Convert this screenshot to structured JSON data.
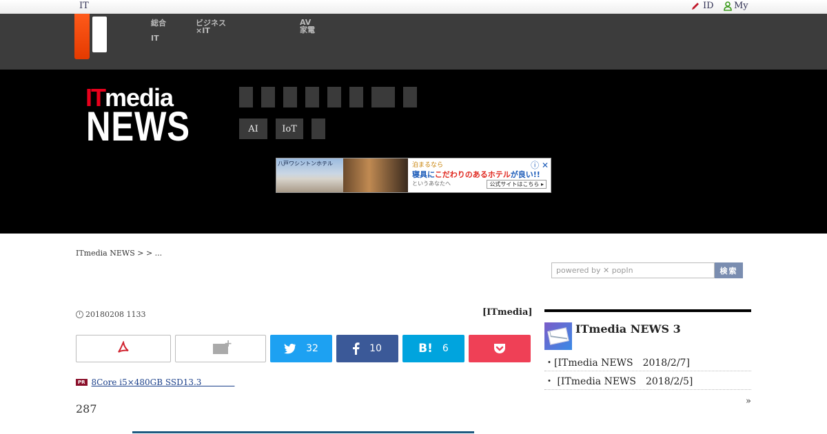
{
  "topbar": {
    "brand": "IT",
    "id_label": "ID",
    "my_label": "My",
    "pencil_icon": "pencil-icon",
    "person_icon": "person-icon"
  },
  "network_nav": {
    "items": [
      {
        "line1": "総合",
        "line2": "IT"
      },
      {
        "line1": "ビジネス",
        "line2": "×IT"
      },
      {
        "line1": "AV",
        "line2": "家電"
      }
    ]
  },
  "header": {
    "logo_it": "IT",
    "logo_media": "media",
    "logo_news": "NEWS",
    "categories_row1": [
      "",
      "",
      "",
      "",
      "",
      "",
      "",
      ""
    ],
    "categories_row2": [
      "AI",
      "IoT",
      ""
    ]
  },
  "ad": {
    "hotel_tag": "八戸ワシントンホテル",
    "line1": "泊まるなら",
    "line2a": "寝具に",
    "line2b": "こだわりのあるホテル",
    "line2c": "が良い!!",
    "line3": "というあなたへ",
    "cta": "公式サイトはこちら ▸",
    "close": "ⓘ ✕"
  },
  "breadcrumb": "ITmedia NEWS >  > ...",
  "search": {
    "placeholder": "powered by ✕ popIn",
    "button_label": "検索"
  },
  "article": {
    "date": "20180208 1133",
    "byline": "[ITmedia]",
    "share": {
      "twitter_count": "32",
      "facebook_count": "10",
      "hatena_label": "B!",
      "hatena_count": "6"
    },
    "pr_badge": "PR",
    "pr_link": "8Core i5×480GB SSD13.3　　　　",
    "count": "287"
  },
  "sidebar": {
    "title": "ITmedia NEWS 3",
    "items": [
      "・[ITmedia NEWS　2018/2/7]",
      "・ [ITmedia NEWS　2018/2/5]"
    ],
    "more": "»"
  },
  "colors": {
    "twitter": "#1da1f2",
    "facebook": "#3b5998",
    "hatena": "#00a4de",
    "pocket": "#ef4056",
    "accent_red": "#e8001c"
  }
}
